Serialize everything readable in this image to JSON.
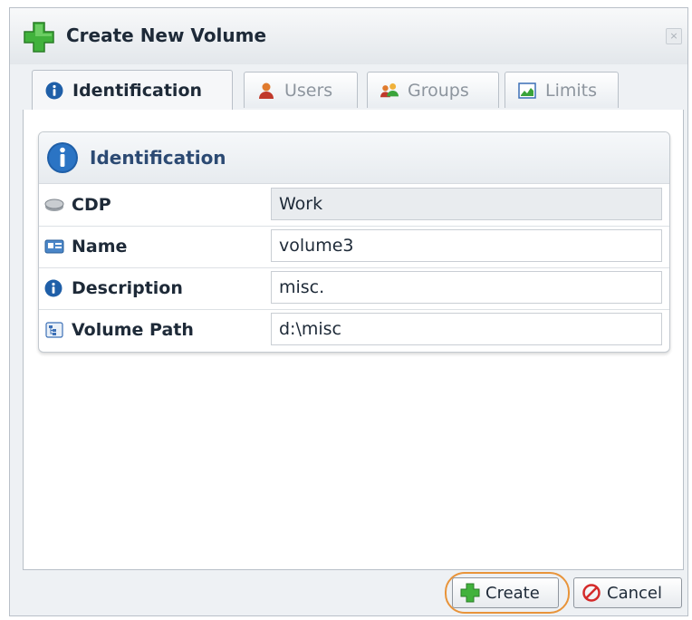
{
  "dialog": {
    "title": "Create New Volume",
    "close_glyph": "×",
    "icon": "add-icon"
  },
  "tabs": [
    {
      "label": "Identification",
      "icon": "info-icon",
      "active": true
    },
    {
      "label": "Users",
      "icon": "user-icon",
      "active": false
    },
    {
      "label": "Groups",
      "icon": "group-icon",
      "active": false
    },
    {
      "label": "Limits",
      "icon": "chart-icon",
      "active": false
    }
  ],
  "section": {
    "title": "Identification",
    "icon": "info-icon"
  },
  "fields": {
    "cdp": {
      "label": "CDP",
      "value": "Work",
      "icon": "disk-icon"
    },
    "name": {
      "label": "Name",
      "value": "volume3",
      "icon": "name-card-icon"
    },
    "description": {
      "label": "Description",
      "value": "misc.",
      "icon": "info-icon"
    },
    "volume_path": {
      "label": "Volume Path",
      "value": "d:\\misc",
      "icon": "folder-tree-icon"
    }
  },
  "buttons": {
    "create": "Create",
    "cancel": "Cancel"
  },
  "colors": {
    "highlight": "#e8943a",
    "accent_green": "#3aa33a",
    "info_blue": "#1f5fa8",
    "cancel_red": "#d42a2a"
  }
}
